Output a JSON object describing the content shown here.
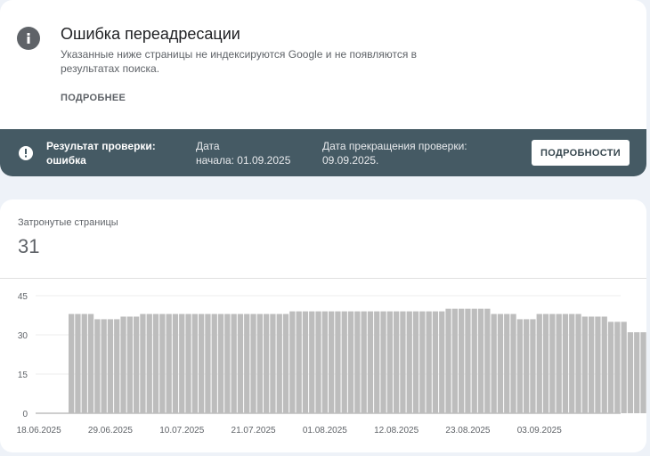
{
  "issue": {
    "icon": "info-icon",
    "title": "Ошибка переадресации",
    "description": "Указанные ниже страницы не индексируются Google и не появляются в результатах поиска.",
    "learn_more_label": "ПОДРОБНЕЕ"
  },
  "validation": {
    "icon": "warning-icon",
    "status_line1": "Результат проверки:",
    "status_line2": "ошибка",
    "start_line1": "Дата",
    "start_line2": "начала: 01.09.2025",
    "end_line1": "Дата прекращения проверки:",
    "end_line2": "09.09.2025.",
    "details_button_label": "ПОДРОБНОСТИ"
  },
  "affected": {
    "label": "Затронутые страницы",
    "count": "31"
  },
  "colors": {
    "banner": "#455a64",
    "bar": "#bdbdbd",
    "background": "#eef2f8"
  },
  "chart_data": {
    "type": "bar",
    "title": "",
    "xlabel": "",
    "ylabel": "",
    "ylim": [
      0,
      45
    ],
    "yticks": [
      0,
      15,
      30,
      45
    ],
    "xtick_labels": [
      "18.06.2025",
      "29.06.2025",
      "10.07.2025",
      "21.07.2025",
      "01.08.2025",
      "12.08.2025",
      "23.08.2025",
      "03.09.2025"
    ],
    "grid": true,
    "categories": [
      "18.06.2025",
      "19.06.2025",
      "20.06.2025",
      "21.06.2025",
      "22.06.2025",
      "23.06.2025",
      "24.06.2025",
      "25.06.2025",
      "26.06.2025",
      "27.06.2025",
      "28.06.2025",
      "29.06.2025",
      "30.06.2025",
      "01.07.2025",
      "02.07.2025",
      "03.07.2025",
      "04.07.2025",
      "05.07.2025",
      "06.07.2025",
      "07.07.2025",
      "08.07.2025",
      "09.07.2025",
      "10.07.2025",
      "11.07.2025",
      "12.07.2025",
      "13.07.2025",
      "14.07.2025",
      "15.07.2025",
      "16.07.2025",
      "17.07.2025",
      "18.07.2025",
      "19.07.2025",
      "20.07.2025",
      "21.07.2025",
      "22.07.2025",
      "23.07.2025",
      "24.07.2025",
      "25.07.2025",
      "26.07.2025",
      "27.07.2025",
      "28.07.2025",
      "29.07.2025",
      "30.07.2025",
      "31.07.2025",
      "01.08.2025",
      "02.08.2025",
      "03.08.2025",
      "04.08.2025",
      "05.08.2025",
      "06.08.2025",
      "07.08.2025",
      "08.08.2025",
      "09.08.2025",
      "10.08.2025",
      "11.08.2025",
      "12.08.2025",
      "13.08.2025",
      "14.08.2025",
      "15.08.2025",
      "16.08.2025",
      "17.08.2025",
      "18.08.2025",
      "19.08.2025",
      "20.08.2025",
      "21.08.2025",
      "22.08.2025",
      "23.08.2025",
      "24.08.2025",
      "25.08.2025",
      "26.08.2025",
      "27.08.2025",
      "28.08.2025",
      "29.08.2025",
      "30.08.2025",
      "31.08.2025",
      "01.09.2025",
      "02.09.2025",
      "03.09.2025",
      "04.09.2025",
      "05.09.2025",
      "06.09.2025",
      "07.09.2025",
      "08.09.2025",
      "09.09.2025",
      "10.09.2025",
      "11.09.2025",
      "12.09.2025",
      "13.09.2025",
      "14.09.2025",
      "15.09.2025"
    ],
    "values": [
      0,
      0,
      0,
      0,
      0,
      38,
      38,
      38,
      38,
      36,
      36,
      36,
      36,
      37,
      37,
      37,
      38,
      38,
      38,
      38,
      38,
      38,
      38,
      38,
      38,
      38,
      38,
      38,
      38,
      38,
      38,
      38,
      38,
      38,
      38,
      38,
      38,
      38,
      38,
      39,
      39,
      39,
      39,
      39,
      39,
      39,
      39,
      39,
      39,
      39,
      39,
      39,
      39,
      39,
      39,
      39,
      39,
      39,
      39,
      39,
      39,
      39,
      39,
      40,
      40,
      40,
      40,
      40,
      40,
      40,
      38,
      38,
      38,
      38,
      36,
      36,
      36,
      38,
      38,
      38,
      38,
      38,
      38,
      38,
      37,
      37,
      37,
      37,
      35,
      35,
      35,
      31,
      31,
      31,
      31
    ]
  }
}
